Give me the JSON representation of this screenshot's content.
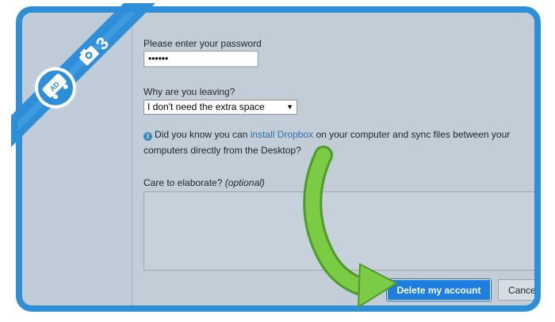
{
  "form": {
    "password_label": "Please enter your password",
    "password_value": "••••••",
    "reason_label": "Why are you leaving?",
    "reason_selected": "I don't need the extra space",
    "info_prefix": "Did you know you can ",
    "info_link": "install Dropbox",
    "info_suffix": " on your computer and sync files between your computers directly from the Desktop?",
    "elaborate_label": "Care to elaborate?",
    "elaborate_optional": "(optional)",
    "elaborate_value": ""
  },
  "buttons": {
    "delete_label": "Delete my account",
    "cancel_label": "Cance"
  },
  "badge": {
    "step_number": "3",
    "logo_text": "AD",
    "colors": {
      "frame": "#2e8fd8",
      "arrow": "#6cc23a",
      "button": "#1d7ee0"
    }
  }
}
